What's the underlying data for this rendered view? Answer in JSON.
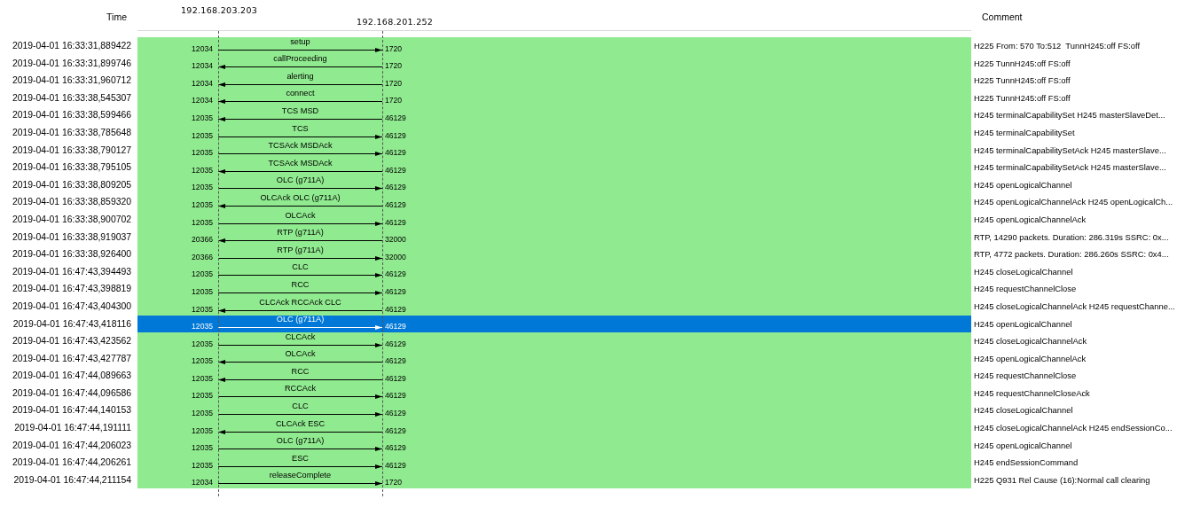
{
  "header": {
    "time": "Time",
    "comment": "Comment",
    "nodes": [
      "192.168.203.203",
      "192.168.201.252"
    ]
  },
  "messages": [
    {
      "time": "2019-04-01 16:33:31,889422",
      "src_port": "12034",
      "label": "setup",
      "kind": "rightward",
      "dst_port": "1720",
      "comment": "H225 From: 570 To:512  TunnH245:off FS:off",
      "selected": false
    },
    {
      "time": "2019-04-01 16:33:31,899746",
      "src_port": "12034",
      "label": "callProceeding",
      "kind": "leftward",
      "dst_port": "1720",
      "comment": "H225 TunnH245:off FS:off",
      "selected": false
    },
    {
      "time": "2019-04-01 16:33:31,960712",
      "src_port": "12034",
      "label": "alerting",
      "kind": "leftward",
      "dst_port": "1720",
      "comment": "H225 TunnH245:off FS:off",
      "selected": false
    },
    {
      "time": "2019-04-01 16:33:38,545307",
      "src_port": "12034",
      "label": "connect",
      "kind": "leftward",
      "dst_port": "1720",
      "comment": "H225 TunnH245:off FS:off",
      "selected": false
    },
    {
      "time": "2019-04-01 16:33:38,599466",
      "src_port": "12035",
      "label": "TCS MSD",
      "kind": "leftward",
      "dst_port": "46129",
      "comment": "H245 terminalCapabilitySet H245 masterSlaveDet...",
      "selected": false
    },
    {
      "time": "2019-04-01 16:33:38,785648",
      "src_port": "12035",
      "label": "TCS",
      "kind": "rightward",
      "dst_port": "46129",
      "comment": "H245 terminalCapabilitySet",
      "selected": false
    },
    {
      "time": "2019-04-01 16:33:38,790127",
      "src_port": "12035",
      "label": "TCSAck MSDAck",
      "kind": "rightward",
      "dst_port": "46129",
      "comment": "H245 terminalCapabilitySetAck H245 masterSlave...",
      "selected": false
    },
    {
      "time": "2019-04-01 16:33:38,795105",
      "src_port": "12035",
      "label": "TCSAck MSDAck",
      "kind": "leftward",
      "dst_port": "46129",
      "comment": "H245 terminalCapabilitySetAck H245 masterSlave...",
      "selected": false
    },
    {
      "time": "2019-04-01 16:33:38,809205",
      "src_port": "12035",
      "label": "OLC (g711A)",
      "kind": "rightward",
      "dst_port": "46129",
      "comment": "H245 openLogicalChannel",
      "selected": false
    },
    {
      "time": "2019-04-01 16:33:38,859320",
      "src_port": "12035",
      "label": "OLCAck OLC (g711A)",
      "kind": "leftward",
      "dst_port": "46129",
      "comment": "H245 openLogicalChannelAck H245 openLogicalCh...",
      "selected": false
    },
    {
      "time": "2019-04-01 16:33:38,900702",
      "src_port": "12035",
      "label": "OLCAck",
      "kind": "rightward",
      "dst_port": "46129",
      "comment": "H245 openLogicalChannelAck",
      "selected": false
    },
    {
      "time": "2019-04-01 16:33:38,919037",
      "src_port": "20366",
      "label": "RTP (g711A)",
      "kind": "leftward",
      "dst_port": "32000",
      "comment": "RTP, 14290 packets. Duration: 286.319s SSRC: 0x...",
      "selected": false
    },
    {
      "time": "2019-04-01 16:33:38,926400",
      "src_port": "20366",
      "label": "RTP (g711A)",
      "kind": "rightward",
      "dst_port": "32000",
      "comment": "RTP, 4772 packets. Duration: 286.260s SSRC: 0x4...",
      "selected": false
    },
    {
      "time": "2019-04-01 16:47:43,394493",
      "src_port": "12035",
      "label": "CLC",
      "kind": "rightward",
      "dst_port": "46129",
      "comment": "H245 closeLogicalChannel",
      "selected": false
    },
    {
      "time": "2019-04-01 16:47:43,398819",
      "src_port": "12035",
      "label": "RCC",
      "kind": "rightward",
      "dst_port": "46129",
      "comment": "H245 requestChannelClose",
      "selected": false
    },
    {
      "time": "2019-04-01 16:47:43,404300",
      "src_port": "12035",
      "label": "CLCAck RCCAck CLC",
      "kind": "leftward",
      "dst_port": "46129",
      "comment": "H245 closeLogicalChannelAck H245 requestChanne...",
      "selected": false
    },
    {
      "time": "2019-04-01 16:47:43,418116",
      "src_port": "12035",
      "label": "OLC (g711A)",
      "kind": "rightward",
      "dst_port": "46129",
      "comment": "H245 openLogicalChannel",
      "selected": true
    },
    {
      "time": "2019-04-01 16:47:43,423562",
      "src_port": "12035",
      "label": "CLCAck",
      "kind": "rightward",
      "dst_port": "46129",
      "comment": "H245 closeLogicalChannelAck",
      "selected": false
    },
    {
      "time": "2019-04-01 16:47:43,427787",
      "src_port": "12035",
      "label": "OLCAck",
      "kind": "leftward",
      "dst_port": "46129",
      "comment": "H245 openLogicalChannelAck",
      "selected": false
    },
    {
      "time": "2019-04-01 16:47:44,089663",
      "src_port": "12035",
      "label": "RCC",
      "kind": "leftward",
      "dst_port": "46129",
      "comment": "H245 requestChannelClose",
      "selected": false
    },
    {
      "time": "2019-04-01 16:47:44,096586",
      "src_port": "12035",
      "label": "RCCAck",
      "kind": "rightward",
      "dst_port": "46129",
      "comment": "H245 requestChannelCloseAck",
      "selected": false
    },
    {
      "time": "2019-04-01 16:47:44,140153",
      "src_port": "12035",
      "label": "CLC",
      "kind": "rightward",
      "dst_port": "46129",
      "comment": "H245 closeLogicalChannel",
      "selected": false
    },
    {
      "time": "2019-04-01 16:47:44,191111",
      "src_port": "12035",
      "label": "CLCAck ESC",
      "kind": "leftward",
      "dst_port": "46129",
      "comment": "H245 closeLogicalChannelAck H245 endSessionCo...",
      "selected": false
    },
    {
      "time": "2019-04-01 16:47:44,206023",
      "src_port": "12035",
      "label": "OLC (g711A)",
      "kind": "rightward",
      "dst_port": "46129",
      "comment": "H245 openLogicalChannel",
      "selected": false
    },
    {
      "time": "2019-04-01 16:47:44,206261",
      "src_port": "12035",
      "label": "ESC",
      "kind": "rightward",
      "dst_port": "46129",
      "comment": "H245 endSessionCommand",
      "selected": false
    },
    {
      "time": "2019-04-01 16:47:44,211154",
      "src_port": "12034",
      "label": "releaseComplete",
      "kind": "rightward",
      "dst_port": "1720",
      "comment": "H225 Q931 Rel Cause (16):Normal call clearing",
      "selected": false
    }
  ]
}
